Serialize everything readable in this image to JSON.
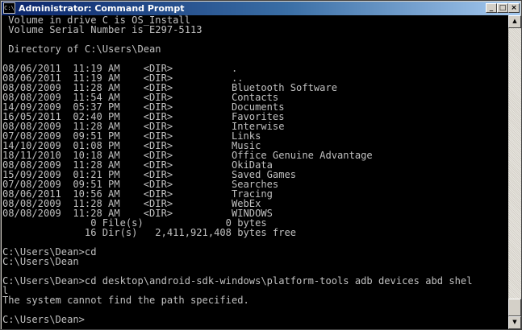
{
  "window": {
    "title": "Administrator: Command Prompt",
    "icon_text": "C:\\",
    "minimize_glyph": "_",
    "maximize_glyph": "□",
    "close_glyph": "×"
  },
  "scrollbar": {
    "up_glyph": "▲",
    "down_glyph": "▼",
    "position_fraction": 1.0
  },
  "console": {
    "lines": [
      " Volume in drive C is OS_Install",
      " Volume Serial Number is E297-5113",
      "",
      " Directory of C:\\Users\\Dean",
      "",
      "08/06/2011  11:19 AM    <DIR>          .",
      "08/06/2011  11:19 AM    <DIR>          ..",
      "08/08/2009  11:28 AM    <DIR>          Bluetooth Software",
      "08/08/2009  11:54 AM    <DIR>          Contacts",
      "14/09/2009  05:37 PM    <DIR>          Documents",
      "16/05/2011  02:40 PM    <DIR>          Favorites",
      "08/08/2009  11:28 AM    <DIR>          Interwise",
      "07/08/2009  09:51 PM    <DIR>          Links",
      "14/10/2009  01:08 PM    <DIR>          Music",
      "18/11/2010  10:18 AM    <DIR>          Office Genuine Advantage",
      "08/08/2009  11:28 AM    <DIR>          OkiData",
      "15/09/2009  01:21 PM    <DIR>          Saved Games",
      "07/08/2009  09:51 PM    <DIR>          Searches",
      "08/06/2011  10:56 AM    <DIR>          Tracing",
      "08/08/2009  11:28 AM    <DIR>          WebEx",
      "08/08/2009  11:28 AM    <DIR>          WINDOWS",
      "               0 File(s)              0 bytes",
      "              16 Dir(s)   2,411,921,408 bytes free",
      "",
      "C:\\Users\\Dean>cd",
      "C:\\Users\\Dean",
      "",
      "C:\\Users\\Dean>cd desktop\\android-sdk-windows\\platform-tools adb devices abd shel",
      "l",
      "The system cannot find the path specified.",
      "",
      "C:\\Users\\Dean>"
    ]
  }
}
